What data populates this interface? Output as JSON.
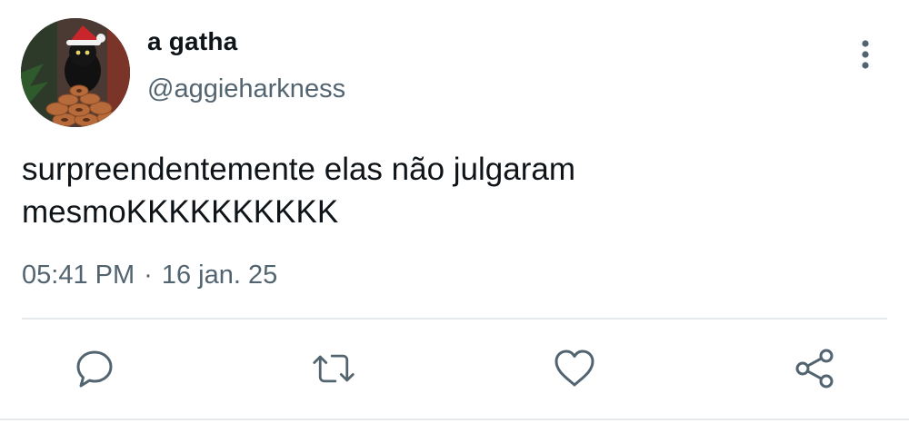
{
  "author": {
    "display_name": "a gatha",
    "handle": "@aggieharkness",
    "avatar_icon": "black-cat-with-santa-hat-and-donuts"
  },
  "tweet": {
    "text": "surpreendentemente elas não julgaram\nmesmoKKKKKKKKKK",
    "time": "05:41 PM",
    "separator": "·",
    "date": "16 jan. 25"
  },
  "actions": {
    "more_icon": "more-vertical-icon",
    "reply_icon": "reply-icon",
    "retweet_icon": "retweet-icon",
    "like_icon": "heart-icon",
    "share_icon": "share-icon"
  },
  "colors": {
    "text_primary": "#0f1419",
    "text_secondary": "#536471",
    "divider": "#e6e9eb"
  }
}
